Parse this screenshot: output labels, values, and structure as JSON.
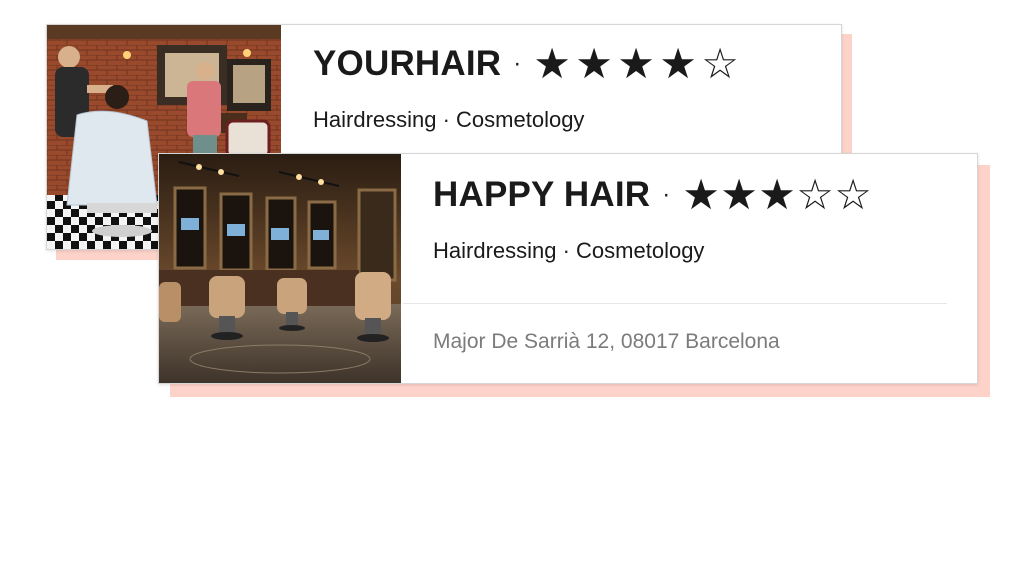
{
  "cards": [
    {
      "name": "YOURHAIR",
      "separator": "·",
      "rating": 4,
      "rating_max": 5,
      "categories": "Hairdressing · Cosmetology",
      "image_alt": "barbershop-photo"
    },
    {
      "name": "HAPPY HAIR",
      "separator": "·",
      "rating": 3,
      "rating_max": 5,
      "categories": "Hairdressing · Cosmetology",
      "address": "Major De Sarrià 12, 08017 Barcelona",
      "image_alt": "salon-interior-photo"
    }
  ],
  "icons": {
    "star_filled": "★",
    "star_empty": "☆"
  },
  "colors": {
    "shadow_accent": "#fdd3c9",
    "title_text": "#1a1a1a",
    "address_text": "#7b7b7b"
  }
}
